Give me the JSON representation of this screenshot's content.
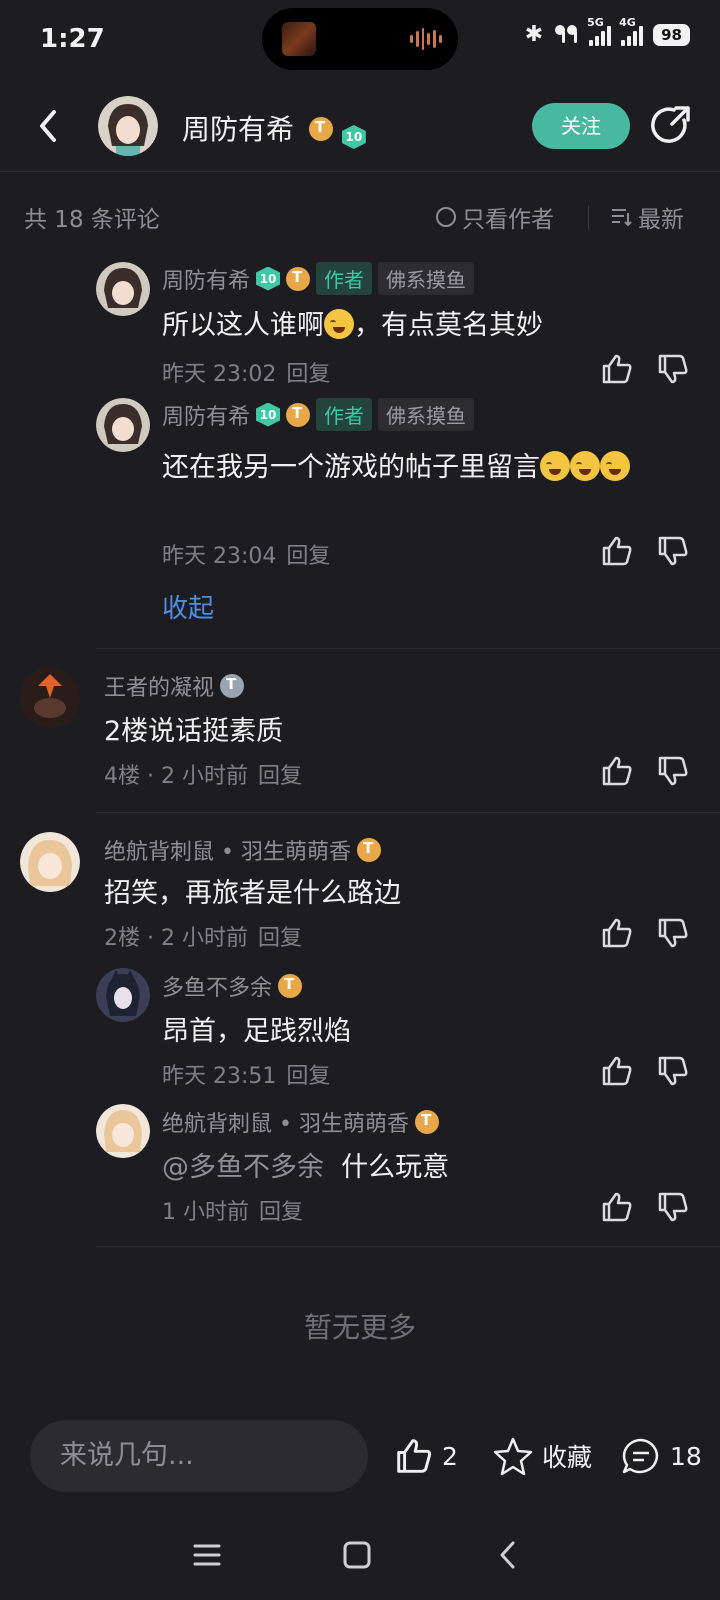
{
  "status": {
    "time": "1:27",
    "net1": "5G",
    "net2": "4G",
    "battery": "98"
  },
  "header": {
    "name": "周防有希",
    "badge_level": "10",
    "follow_label": "关注"
  },
  "filter": {
    "count_label": "共 18 条评论",
    "author_only_label": "只看作者",
    "sort_label": "最新"
  },
  "comments": [
    {
      "user": "周防有希",
      "level": "10",
      "author_tag": "作者",
      "group_tag": "佛系摸鱼",
      "text": "所以这人谁啊",
      "text_after": "，有点莫名其妙",
      "time": "昨天 23:02",
      "reply": "回复"
    },
    {
      "user": "周防有希",
      "level": "10",
      "author_tag": "作者",
      "group_tag": "佛系摸鱼",
      "text": "还在我另一个游戏的帖子里留言",
      "time": "昨天 23:04",
      "reply": "回复"
    },
    {
      "user": "王者的凝视",
      "text": "2楼说话挺素质",
      "floor": "4楼",
      "time": "2 小时前",
      "reply": "回复"
    },
    {
      "user": "绝航背刺鼠 • 羽生萌萌香",
      "text": "招笑，再旅者是什么路边",
      "floor": "2楼",
      "time": "2 小时前",
      "reply": "回复"
    },
    {
      "user": "多鱼不多余",
      "text": "昂首，足践烈焰",
      "time": "昨天 23:51",
      "reply": "回复"
    },
    {
      "user": "绝航背刺鼠 • 羽生萌萌香",
      "mention": "@多鱼不多余",
      "text": "什么玩意",
      "time": "1 小时前",
      "reply": "回复"
    }
  ],
  "collapse_label": "收起",
  "no_more_label": "暂无更多",
  "bottom": {
    "input_placeholder": "来说几句...",
    "like_count": "2",
    "favorite_label": "收藏",
    "comment_count": "18"
  },
  "colors": {
    "background": "#1d1d21",
    "accent": "#48b9a0",
    "link": "#4d8fe0"
  }
}
